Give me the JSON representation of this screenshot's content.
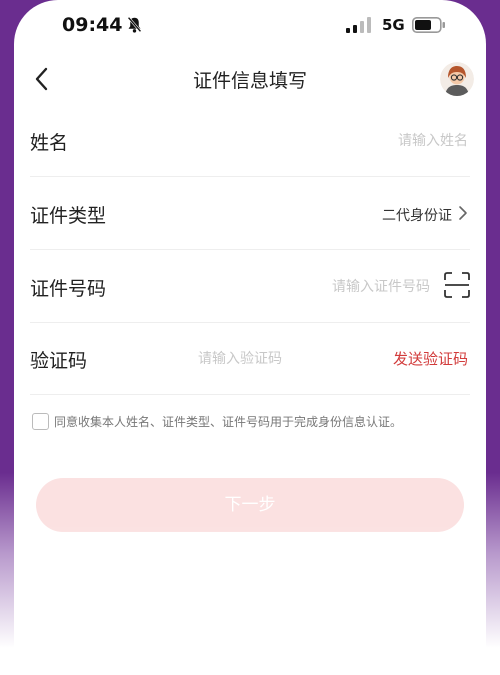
{
  "status_bar": {
    "time": "09:44",
    "network": "5G",
    "icons": [
      "bell-muted-icon",
      "signal-icon",
      "battery-icon"
    ]
  },
  "nav": {
    "title": "证件信息填写",
    "back_icon": "chevron-left-icon",
    "avatar_icon": "user-avatar-icon"
  },
  "form": {
    "name": {
      "label": "姓名",
      "placeholder": "请输入姓名"
    },
    "id_type": {
      "label": "证件类型",
      "value": "二代身份证",
      "icon": "chevron-right-icon"
    },
    "id_number": {
      "label": "证件号码",
      "placeholder": "请输入证件号码",
      "icon": "scan-icon"
    },
    "code": {
      "label": "验证码",
      "placeholder": "请输入验证码",
      "send_label": "发送验证码"
    }
  },
  "agreement": {
    "checked": false,
    "text": "同意收集本人姓名、证件类型、证件号码用于完成身份信息认证。"
  },
  "next_button": {
    "label": "下一步"
  },
  "colors": {
    "frame": "#6a2d8f",
    "accent": "#d23b3b",
    "button_disabled": "#fbe1e1"
  }
}
